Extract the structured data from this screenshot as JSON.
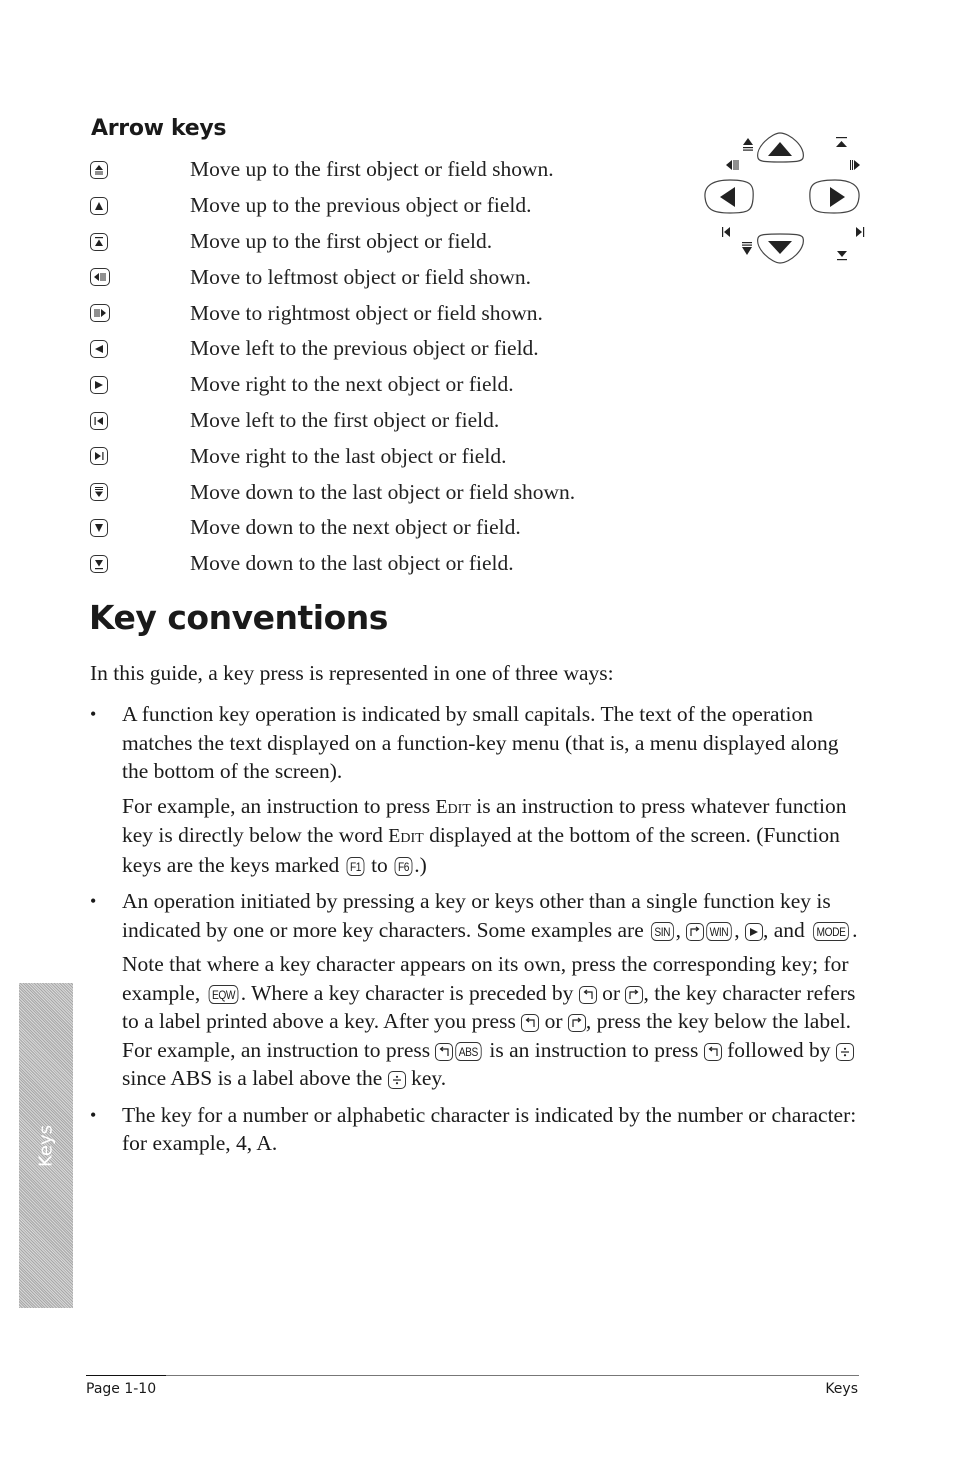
{
  "arrow_keys": {
    "title": "Arrow keys",
    "items": [
      {
        "icon": "up-first-shown-icon",
        "desc": "Move up to the first object or field shown."
      },
      {
        "icon": "up-arrow-icon",
        "desc": "Move up to the previous object or field."
      },
      {
        "icon": "up-first-icon",
        "desc": "Move up to the first object or field."
      },
      {
        "icon": "leftmost-shown-icon",
        "desc": "Move to leftmost object or field shown."
      },
      {
        "icon": "rightmost-shown-icon",
        "desc": "Move to rightmost object or field shown."
      },
      {
        "icon": "left-arrow-icon",
        "desc": "Move left to the previous object or field."
      },
      {
        "icon": "right-arrow-icon",
        "desc": "Move right to the next object or field."
      },
      {
        "icon": "left-first-icon",
        "desc": "Move left to the first object or field."
      },
      {
        "icon": "right-last-icon",
        "desc": "Move right to the last object or field."
      },
      {
        "icon": "down-last-shown-icon",
        "desc": "Move down to the last object or field shown."
      },
      {
        "icon": "down-arrow-icon",
        "desc": "Move down to the next object or field."
      },
      {
        "icon": "down-last-icon",
        "desc": "Move down to the last object or field."
      }
    ]
  },
  "key_conventions": {
    "title": "Key conventions",
    "intro": "In this guide, a key press is represented in one of three ways:",
    "bullet1": {
      "p1": "A function key operation is indicated by small capitals. The text of the operation matches the text displayed on a function-key menu (that is, a menu displayed along the bottom of the screen).",
      "p2_a": "For example, an instruction to press ",
      "p2_edit1": "Edit",
      "p2_b": " is an instruction to press whatever function key is directly below the word ",
      "p2_edit2": "Edit",
      "p2_c": " displayed at the bottom of the screen. (Function keys are the keys marked ",
      "p2_f1": "F1",
      "p2_d": " to ",
      "p2_f6": "F6",
      "p2_e": ".)"
    },
    "bullet2": {
      "p1_a": "An operation initiated by pressing a key or keys other than a single function key is indicated by one or more key characters. Some examples are ",
      "k_sin": "SIN",
      "p1_b": ", ",
      "k_win": "WIN",
      "p1_c": ", ",
      "p1_d": ", and ",
      "k_mode": "MODE",
      "p1_e": ".",
      "p2_a": "Note that where a key character appears on its own, press the corresponding key; for example, ",
      "k_eqw": "EQW",
      "p2_b": ". Where a key character is preceded by ",
      "p2_c": " or ",
      "p2_d": ", the key character refers to a label printed above a key. After you press ",
      "p2_e": " or ",
      "p2_f": ", press the key below the label. For example, an instruction to press ",
      "k_abs": "ABS",
      "p2_g": " is an instruction to press ",
      "p2_h": " followed by ",
      "p2_i": " since ABS is a label above the ",
      "p2_j": " key."
    },
    "bullet3": "The key for a number or alphabetic character is indicated by the number or character: for example, 4, A."
  },
  "side_tab": "Keys",
  "footer": {
    "page": "Page 1-10",
    "section": "Keys"
  }
}
